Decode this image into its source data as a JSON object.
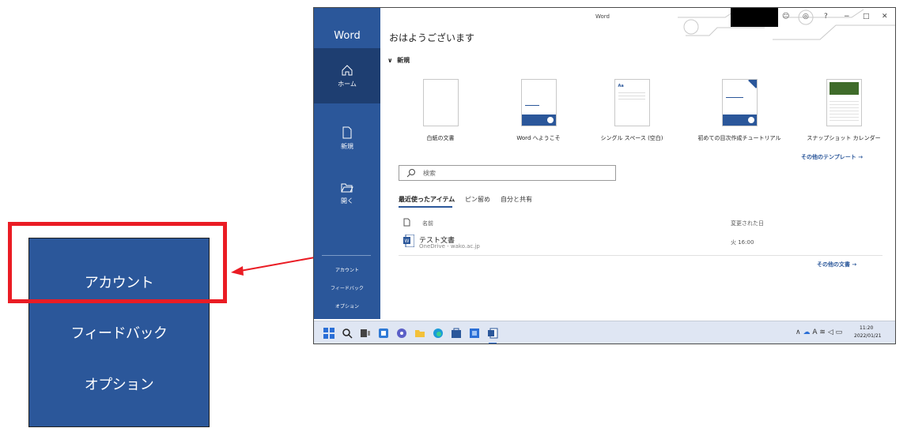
{
  "zoom_panel": {
    "account": "アカウント",
    "feedback": "フィードバック",
    "options": "オプション"
  },
  "window": {
    "title": "Word"
  },
  "sidebar": {
    "app_name": "Word",
    "items": [
      {
        "label": "ホーム"
      },
      {
        "label": "新規"
      },
      {
        "label": "開く"
      }
    ],
    "bottom": [
      {
        "label": "アカウント"
      },
      {
        "label": "フィードバック"
      },
      {
        "label": "オプション"
      }
    ]
  },
  "main": {
    "greeting": "おはようございます",
    "new_section": "新規",
    "templates": [
      {
        "label": "白紙の文書"
      },
      {
        "label": "Word へようこそ"
      },
      {
        "label": "シングル スペース (空白)"
      },
      {
        "label": "初めての目次作成チュートリアル"
      },
      {
        "label": "スナップショット カレンダー"
      }
    ],
    "more_templates": "その他のテンプレート →",
    "search_placeholder": "検索",
    "tabs": [
      "最近使ったアイテム",
      "ピン留め",
      "自分と共有"
    ],
    "columns": {
      "name": "名前",
      "date": "変更された日"
    },
    "documents": [
      {
        "title": "テスト文書",
        "location": "OneDrive - wako.ac.jp",
        "date": "火 16:00"
      }
    ],
    "more_docs": "その他の文書 →"
  },
  "taskbar": {
    "time": "11:20",
    "date": "2022/01/21"
  },
  "colors": {
    "word_blue": "#2b579a",
    "highlight_red": "#ea1c24"
  }
}
